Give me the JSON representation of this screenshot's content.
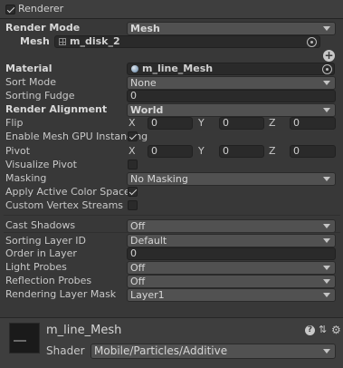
{
  "component": {
    "title": "Renderer",
    "enabled": true
  },
  "render_mode": {
    "label": "Render Mode",
    "value": "Mesh"
  },
  "mesh": {
    "label": "Mesh",
    "value": "m_disk_2"
  },
  "material": {
    "label": "Material",
    "value": "m_line_Mesh"
  },
  "sort_mode": {
    "label": "Sort Mode",
    "value": "None"
  },
  "sorting_fudge": {
    "label": "Sorting Fudge",
    "value": "0"
  },
  "render_alignment": {
    "label": "Render Alignment",
    "value": "World"
  },
  "flip": {
    "label": "Flip",
    "x": "0",
    "y": "0",
    "z": "0"
  },
  "gpu_instancing": {
    "label": "Enable Mesh GPU Instancing",
    "checked": true
  },
  "pivot": {
    "label": "Pivot",
    "x": "0",
    "y": "0",
    "z": "0"
  },
  "visualize_pivot": {
    "label": "Visualize Pivot",
    "checked": false
  },
  "masking": {
    "label": "Masking",
    "value": "No Masking"
  },
  "active_color_space": {
    "label": "Apply Active Color Space",
    "checked": true
  },
  "custom_vertex_streams": {
    "label": "Custom Vertex Streams",
    "checked": false
  },
  "cast_shadows": {
    "label": "Cast Shadows",
    "value": "Off"
  },
  "sorting_layer": {
    "label": "Sorting Layer ID",
    "value": "Default"
  },
  "order_in_layer": {
    "label": "Order in Layer",
    "value": "0"
  },
  "light_probes": {
    "label": "Light Probes",
    "value": "Off"
  },
  "reflection_probes": {
    "label": "Reflection Probes",
    "value": "Off"
  },
  "rendering_layer_mask": {
    "label": "Rendering Layer Mask",
    "value": "Layer1"
  },
  "axes": {
    "x": "X",
    "y": "Y",
    "z": "Z"
  },
  "material_panel": {
    "name": "m_line_Mesh",
    "shader_label": "Shader",
    "shader_value": "Mobile/Particles/Additive"
  },
  "icons": {
    "help": "question-circle-icon",
    "settings": "sliders-icon",
    "gear": "gear-icon",
    "add": "plus-circle-icon"
  }
}
